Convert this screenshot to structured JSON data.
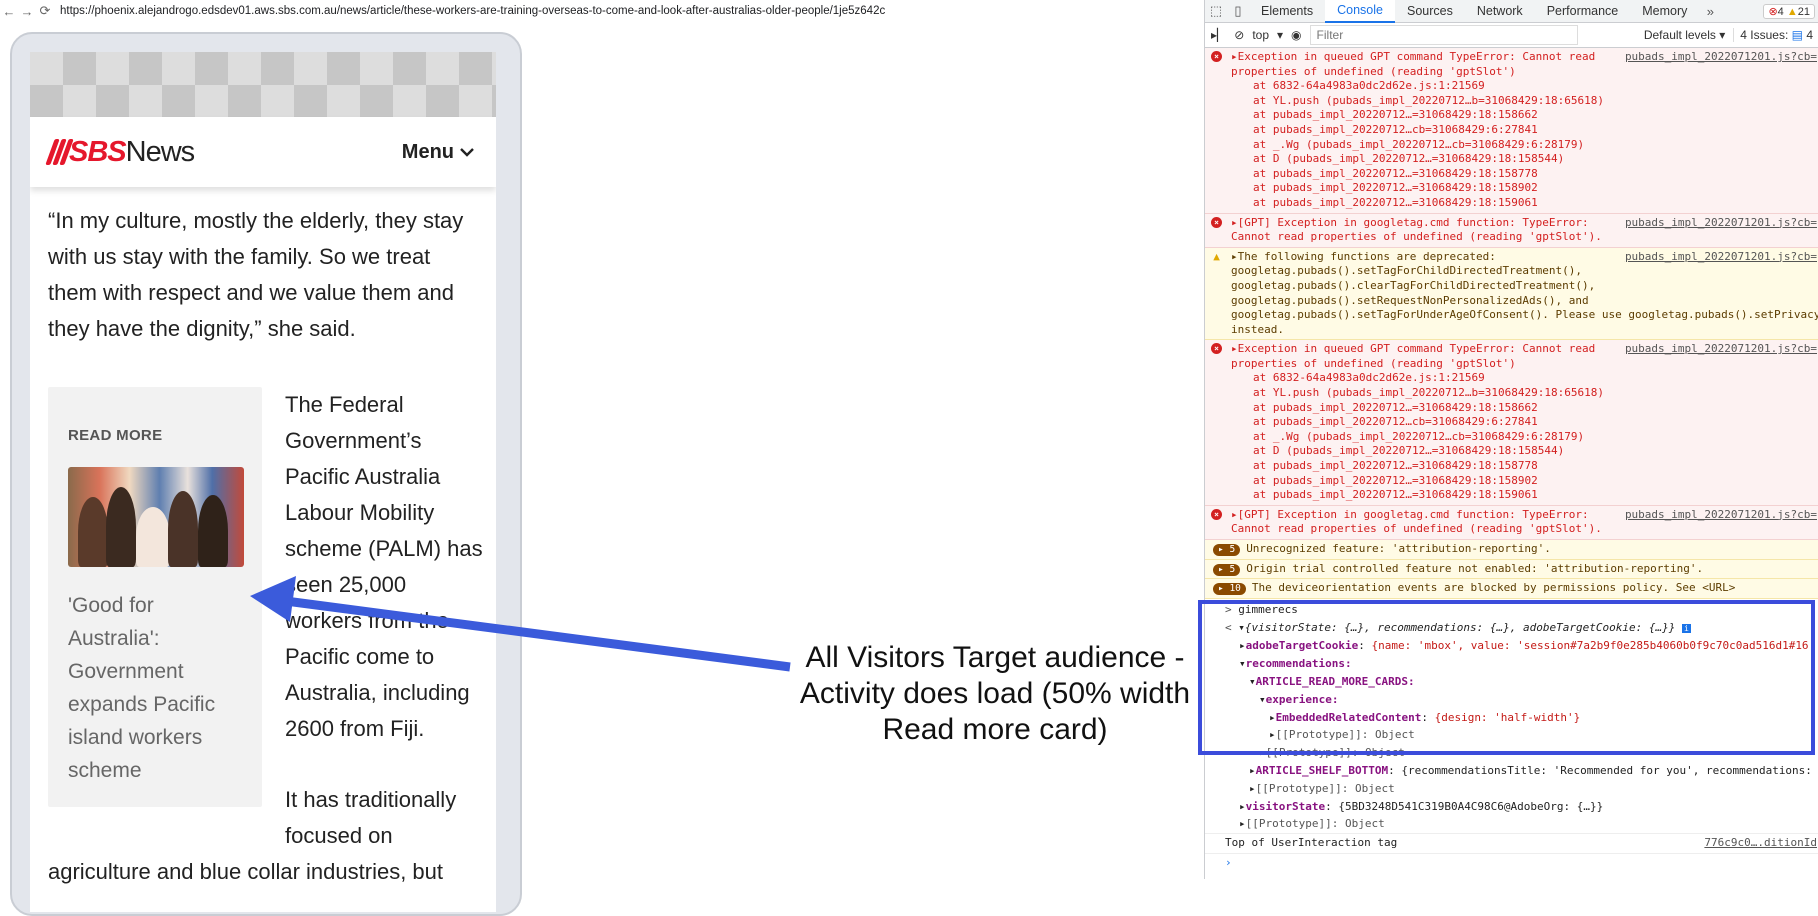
{
  "browser": {
    "url": "https://phoenix.alejandrogo.edsdev01.aws.sbs.com.au/news/article/these-workers-are-training-overseas-to-come-and-look-after-australias-older-people/1je5z642c"
  },
  "site": {
    "logo_sbs": "SBS",
    "logo_news": "News",
    "menu_label": "Menu"
  },
  "article": {
    "quote": "“In my culture, mostly the elderly, they stay with us stay with the family. So we treat them with respect and we value them and they have the dignity,” she said.",
    "read_more_label": "READ MORE",
    "read_more_title": "'Good for Australia': Government expands Pacific island workers scheme",
    "paragraph1": "The Federal Government’s Pacific Australia Labour Mobility scheme (PALM) has seen 25,000 workers from the Pacific come to Australia, including 2600 from Fiji.",
    "paragraph2": "It has traditionally focused on",
    "paragraph3": "agriculture and blue collar industries, but"
  },
  "annotation": {
    "text": "All Visitors Target audience - Activity does load (50% width Read more card)",
    "color": "#3b5bdb"
  },
  "devtools": {
    "tabs": [
      "Elements",
      "Console",
      "Sources",
      "Network",
      "Performance",
      "Memory"
    ],
    "active_tab": "Console",
    "error_count": "4",
    "warning_count": "21",
    "context": "top",
    "filter_placeholder": "Filter",
    "levels": "Default levels",
    "issues": "4 Issues:",
    "issues_count": "4",
    "logs": {
      "e1_line1": "Exception in queued GPT command TypeError: Cannot read",
      "e1_line2": "properties of undefined (reading 'gptSlot')",
      "e1_src": "pubads_impl_2022071201.js?cb=",
      "stack": [
        "at 6832-64a4983a0dc2d62e.js:1:21569",
        "at YL.push (pubads_impl_20220712…b=31068429:18:65618)",
        "at pubads_impl_20220712…=31068429:18:158662",
        "at pubads_impl_20220712…cb=31068429:6:27841",
        "at _.Wg (pubads_impl_20220712…cb=31068429:6:28179)",
        "at D (pubads_impl_20220712…=31068429:18:158544)",
        "at pubads_impl_20220712…=31068429:18:158778",
        "at pubads_impl_20220712…=31068429:18:158902",
        "at pubads_impl_20220712…=31068429:18:159061"
      ],
      "e2_line1": "[GPT] Exception in googletag.cmd function: TypeError:",
      "e2_line2": "Cannot read properties of undefined (reading 'gptSlot').",
      "w1_line1": "The following functions are deprecated:",
      "w1_line2": "googletag.pubads().setTagForChildDirectedTreatment(),",
      "w1_line3": "googletag.pubads().clearTagForChildDirectedTreatment(),",
      "w1_line4": "googletag.pubads().setRequestNonPersonalizedAds(), and",
      "w1_line5": "googletag.pubads().setTagForUnderAgeOfConsent(). Please use googletag.pubads().setPrivacySettings()",
      "w1_line6": "instead.",
      "i1_count": "5",
      "i1_text": "Unrecognized feature: 'attribution-reporting'.",
      "i2_count": "5",
      "i2_text": "Origin trial controlled feature not enabled: 'attribution-reporting'.",
      "i3_count": "10",
      "i3_text": "The deviceorientation events are blocked by permissions policy. See <URL>",
      "cmd": "gimmerecs",
      "result_summary": "{visitorState: {…}, recommendations: {…}, adobeTargetCookie: {…}}",
      "adobe_key": "adobeTargetCookie",
      "adobe_val": "{name: 'mbox', value: 'session#7a2b9f0e285b4060b0f9c70c0ad516d1#16",
      "rec_key": "recommendations:",
      "arm_key": "ARTICLE_READ_MORE_CARDS:",
      "exp_key": "experience:",
      "erc_key": "EmbeddedRelatedContent",
      "erc_val": "{design: 'half-width'}",
      "proto": "[[Prototype]]: Object",
      "shelf_key": "ARTICLE_SHELF_BOTTOM",
      "shelf_val": "{recommendationsTitle: 'Recommended for you', recommendations:",
      "vs_key": "visitorState",
      "vs_val": "{5BD3248D541C319B0A4C98C6@AdobeOrg: {…}}",
      "top_tag": "Top of UserInteraction tag",
      "top_tag_src": "776c9c0….ditionId"
    }
  }
}
